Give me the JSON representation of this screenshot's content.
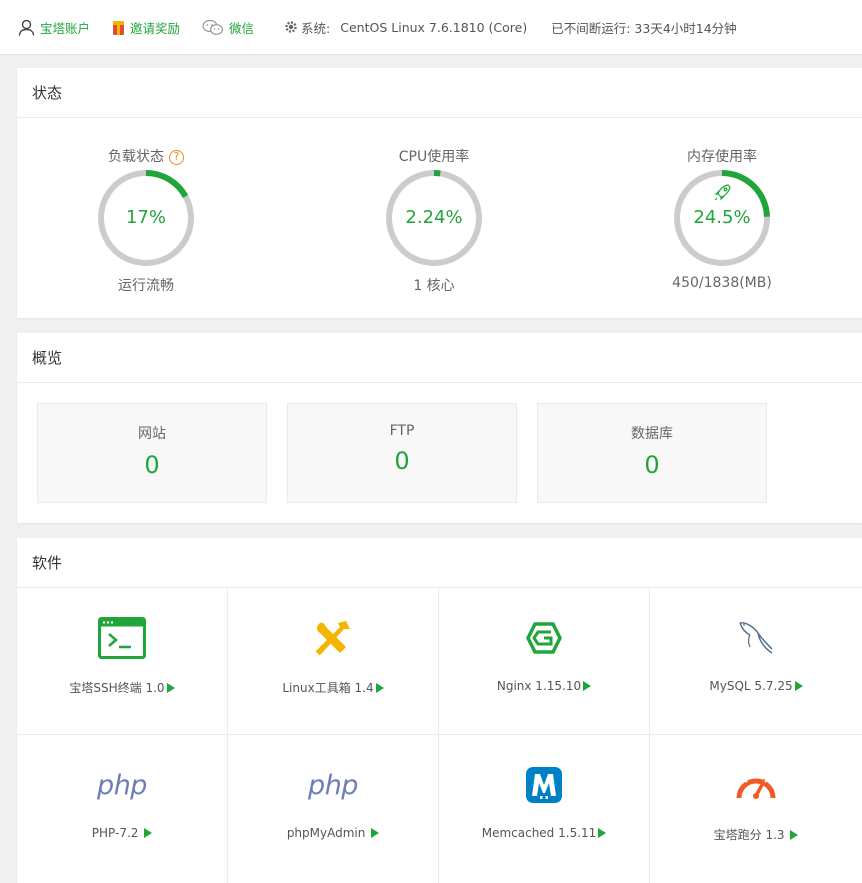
{
  "topbar": {
    "account": "宝塔账户",
    "invite": "邀请奖励",
    "wechat": "微信",
    "system_label": "系统:",
    "system_value": "CentOS Linux 7.6.1810 (Core)",
    "uptime": "已不间断运行: 33天4小时14分钟"
  },
  "status": {
    "title": "状态",
    "gauges": [
      {
        "title": "负载状态",
        "value": "17%",
        "percent": 17,
        "sub": "运行流畅",
        "help": "?"
      },
      {
        "title": "CPU使用率",
        "value": "2.24%",
        "percent": 2.24,
        "sub": "1 核心"
      },
      {
        "title": "内存使用率",
        "value": "24.5%",
        "percent": 24.5,
        "sub": "450/1838(MB)",
        "icon": "rocket-icon"
      }
    ]
  },
  "overview": {
    "title": "概览",
    "cards": [
      {
        "label": "网站",
        "value": "0"
      },
      {
        "label": "FTP",
        "value": "0"
      },
      {
        "label": "数据库",
        "value": "0"
      }
    ]
  },
  "software": {
    "title": "软件",
    "items": [
      {
        "name": "宝塔SSH终端 1.0",
        "icon": "terminal-icon"
      },
      {
        "name": "Linux工具箱 1.4",
        "icon": "tools-icon"
      },
      {
        "name": "Nginx 1.15.10",
        "icon": "nginx-icon"
      },
      {
        "name": "MySQL 5.7.25",
        "icon": "mysql-dolphin-icon"
      },
      {
        "name": "PHP-7.2",
        "icon": "php-icon",
        "logo_text": "php"
      },
      {
        "name": "phpMyAdmin",
        "icon": "php-icon",
        "logo_text": "php"
      },
      {
        "name": "Memcached 1.5.11",
        "icon": "memcached-icon"
      },
      {
        "name": "宝塔跑分 1.3",
        "icon": "speedometer-icon"
      }
    ]
  },
  "colors": {
    "accent": "#20a53a",
    "ring_track": "#cccccc",
    "help": "#e58b22"
  }
}
